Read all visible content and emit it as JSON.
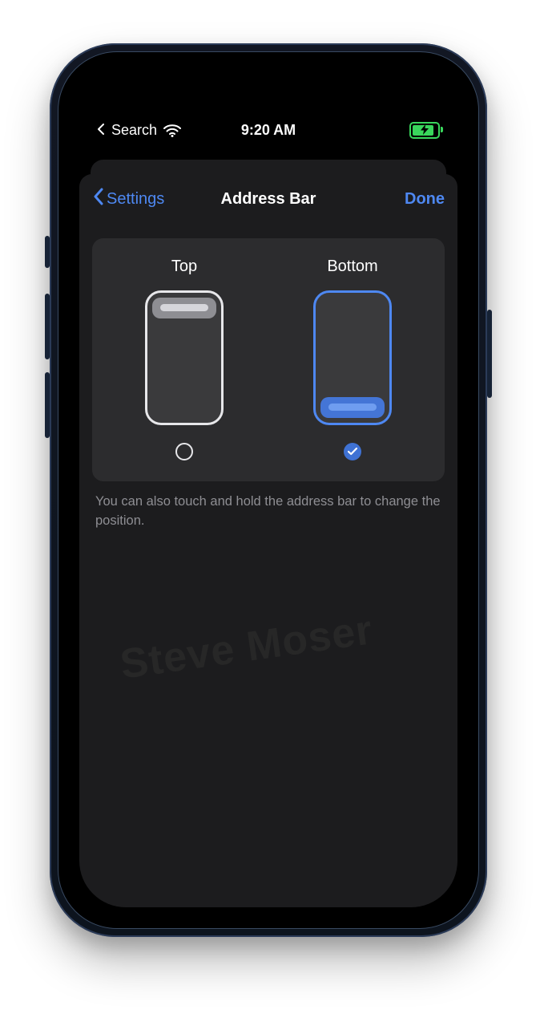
{
  "status": {
    "back_app": "Search",
    "time": "9:20 AM"
  },
  "nav": {
    "back_label": "Settings",
    "title": "Address Bar",
    "done_label": "Done"
  },
  "options": {
    "top": {
      "label": "Top",
      "selected": false
    },
    "bottom": {
      "label": "Bottom",
      "selected": true
    }
  },
  "note": "You can also touch and hold the address bar to change the position.",
  "watermark": "Steve Moser"
}
